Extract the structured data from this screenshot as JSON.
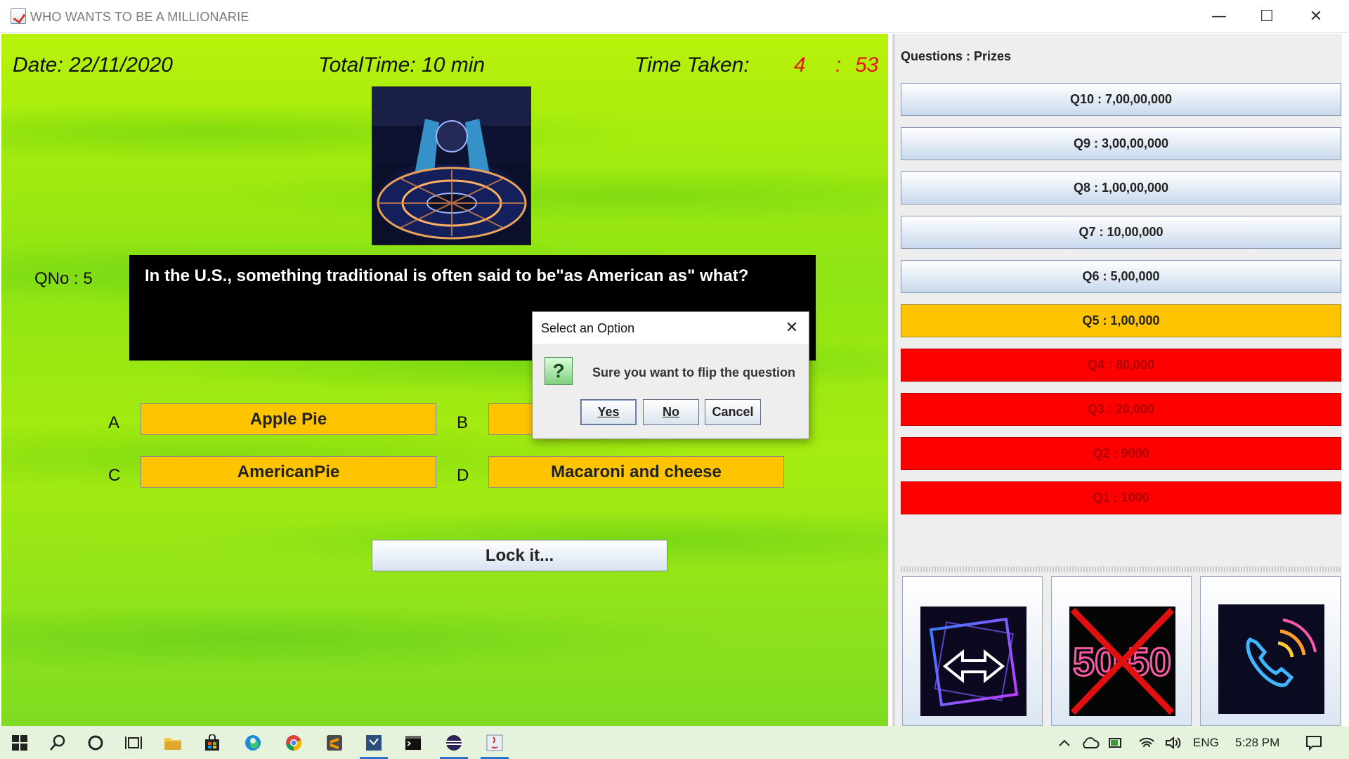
{
  "window": {
    "title": "WHO WANTS TO BE A MILLIONARIE",
    "controls": {
      "minimize": "—",
      "maximize": "☐",
      "close": "✕"
    }
  },
  "game": {
    "date_label": "Date: 22/11/2020",
    "total_time_label": "TotalTime: 10 min",
    "time_taken_label": "Time Taken:",
    "time_minutes": "4",
    "time_separator": ":",
    "time_seconds": "53",
    "qno_label": "QNo : 5",
    "question": "In the U.S., something traditional is often said to be\"as American as\" what?",
    "options": [
      {
        "letter": "A",
        "text": "Apple Pie"
      },
      {
        "letter": "B",
        "text": ""
      },
      {
        "letter": "C",
        "text": "AmericanPie"
      },
      {
        "letter": "D",
        "text": "Macaroni and cheese"
      }
    ],
    "lock_label": "Lock it...",
    "show_image_icon": "millionaire-stage-image"
  },
  "prizes": {
    "header": "Questions : Prizes",
    "items": [
      {
        "label": "Q10 : 7,00,00,000",
        "state": "pending"
      },
      {
        "label": "Q9 : 3,00,00,000",
        "state": "pending"
      },
      {
        "label": "Q8 : 1,00,00,000",
        "state": "pending"
      },
      {
        "label": "Q7 : 10,00,000",
        "state": "pending"
      },
      {
        "label": "Q6 : 5,00,000",
        "state": "pending"
      },
      {
        "label": "Q5 : 1,00,000",
        "state": "current"
      },
      {
        "label": "Q4 : 80,000",
        "state": "done"
      },
      {
        "label": "Q3 : 20,000",
        "state": "done"
      },
      {
        "label": "Q2 : 9000",
        "state": "done"
      },
      {
        "label": "Q1 : 1000",
        "state": "done"
      }
    ],
    "colors": {
      "pending": "#dce8f5",
      "current": "#ffc400",
      "done": "#ff0000"
    }
  },
  "lifelines": [
    {
      "name": "flip-question",
      "icon": "flip-arrows-icon",
      "used": false
    },
    {
      "name": "fifty-fifty",
      "icon": "fifty-fifty-icon",
      "text": "50 50",
      "used": true
    },
    {
      "name": "phone-a-friend",
      "icon": "phone-icon",
      "used": false
    }
  ],
  "dialog": {
    "title": "Select an Option",
    "message": "Sure you want to flip the question",
    "icon": "question-icon",
    "buttons": {
      "yes": "Yes",
      "no": "No",
      "cancel": "Cancel"
    }
  },
  "taskbar": {
    "icons": [
      "windows-start-icon",
      "search-icon",
      "cortana-icon",
      "task-view-icon",
      "file-explorer-icon",
      "store-icon",
      "edge-icon",
      "chrome-icon",
      "sublime-text-icon",
      "visual-studio-icon",
      "terminal-icon",
      "eclipse-icon",
      "java-app-icon"
    ],
    "tray": {
      "language": "ENG",
      "time": "5:28 PM",
      "icons": [
        "chevron-up-icon",
        "onedrive-icon",
        "battery-icon",
        "wifi-icon",
        "volume-icon",
        "notification-icon"
      ]
    }
  }
}
